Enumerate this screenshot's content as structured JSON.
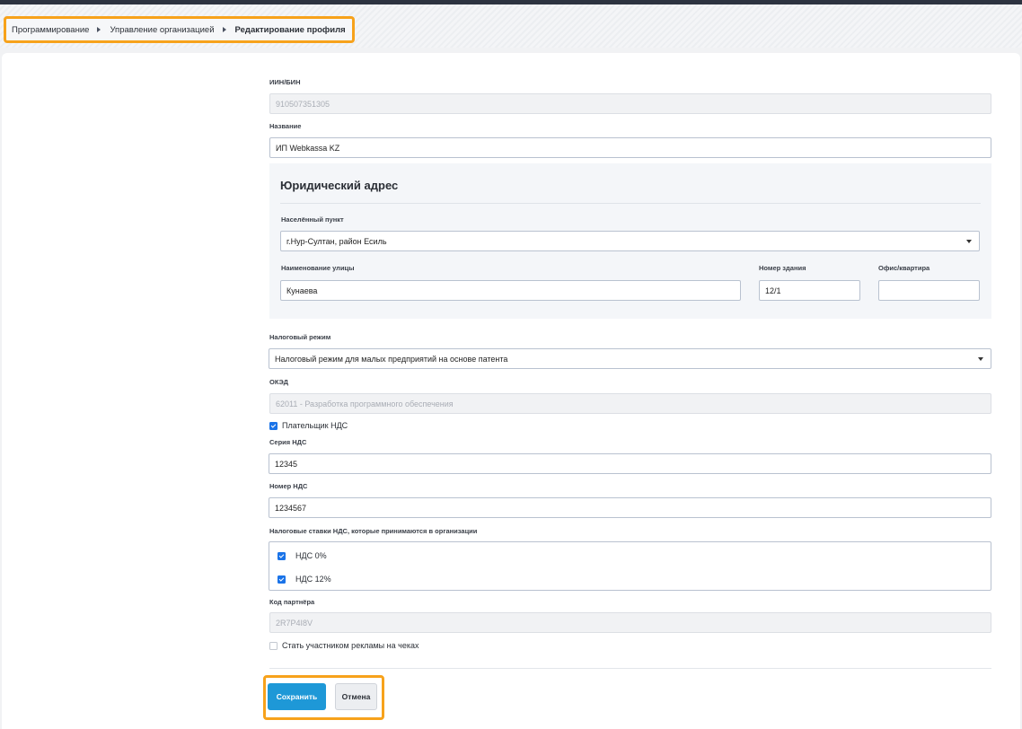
{
  "breadcrumb": {
    "items": [
      "Программирование",
      "Управление организацией",
      "Редактирование профиля"
    ]
  },
  "form": {
    "iin": {
      "label": "ИИН/БИН",
      "value": "910507351305"
    },
    "name": {
      "label": "Название",
      "value": "ИП Webkassa KZ"
    },
    "address": {
      "title": "Юридический адрес",
      "locality": {
        "label": "Населённый пункт",
        "value": "г.Нур-Султан, район Есиль"
      },
      "street": {
        "label": "Наименование улицы",
        "value": "Кунаева"
      },
      "building": {
        "label": "Номер здания",
        "value": "12/1"
      },
      "office": {
        "label": "Офис/квартира",
        "value": ""
      }
    },
    "tax_regime": {
      "label": "Налоговый режим",
      "value": "Налоговый режим для малых предприятий на основе патента"
    },
    "oked": {
      "label": "ОКЭД",
      "value": "62011 - Разработка программного обеспечения"
    },
    "vat_payer": {
      "label": "Плательщик НДС",
      "checked": true
    },
    "vat_series": {
      "label": "Серия НДС",
      "value": "12345"
    },
    "vat_number": {
      "label": "Номер НДС",
      "value": "1234567"
    },
    "vat_rates": {
      "label": "Налоговые ставки НДС, которые принимаются в организации",
      "options": [
        {
          "label": "НДС 0%",
          "checked": true
        },
        {
          "label": "НДС 12%",
          "checked": true
        }
      ]
    },
    "partner_code": {
      "label": "Код партнёра",
      "value": "2R7P4I8V"
    },
    "ads": {
      "label": "Стать участником рекламы на чеках",
      "checked": false
    }
  },
  "actions": {
    "save_label": "Сохранить",
    "cancel_label": "Отмена"
  },
  "colors": {
    "accent": "#1e98d7",
    "highlight": "#f7a21b",
    "checkbox": "#1a73e8"
  }
}
